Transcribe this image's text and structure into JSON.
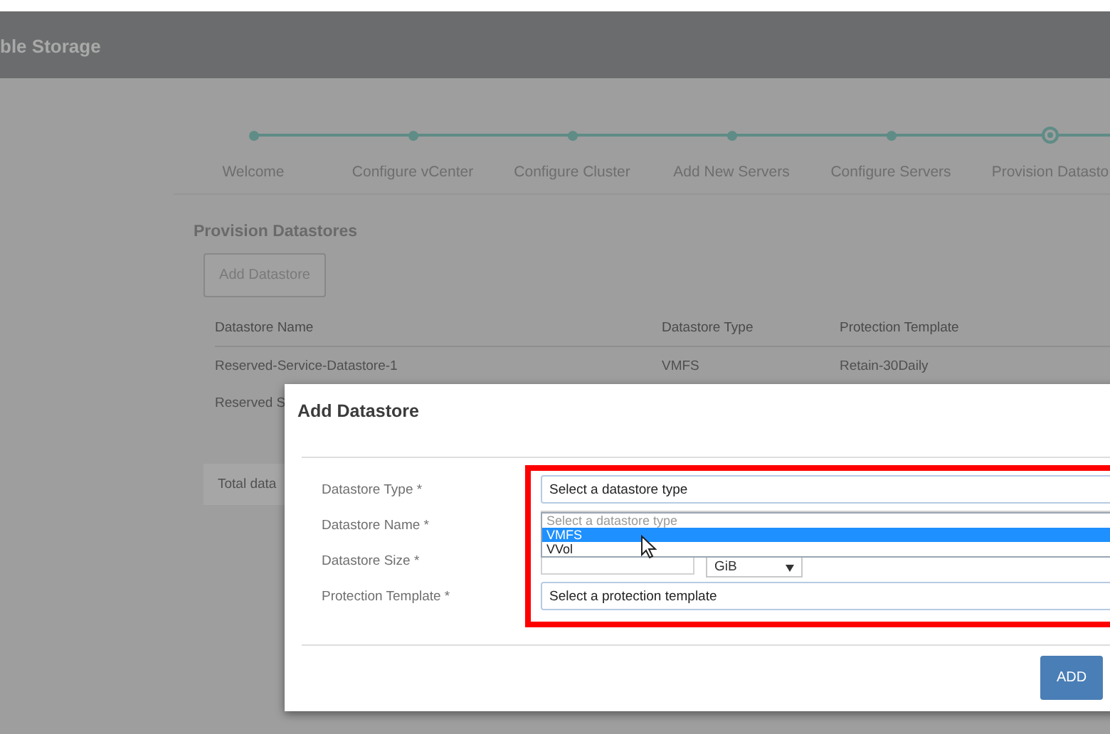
{
  "header": {
    "title": "ble Storage"
  },
  "steps": [
    {
      "label": "Welcome",
      "current": false
    },
    {
      "label": "Configure vCenter",
      "current": false
    },
    {
      "label": "Configure Cluster",
      "current": false
    },
    {
      "label": "Add New Servers",
      "current": false
    },
    {
      "label": "Configure Servers",
      "current": false
    },
    {
      "label": "Provision Datasto",
      "current": true
    }
  ],
  "section": {
    "title": "Provision Datastores",
    "add_button": "Add Datastore"
  },
  "table": {
    "columns": [
      "Datastore Name",
      "Datastore Type",
      "Protection Template"
    ],
    "rows": [
      [
        "Reserved-Service-Datastore-1",
        "VMFS",
        "Retain-30Daily"
      ],
      [
        "Reserved S"
      ]
    ]
  },
  "total": "Total data",
  "dialog": {
    "title": "Add Datastore",
    "fields": [
      {
        "kind": "select",
        "label": "Datastore Type *",
        "value": "Select a datastore type"
      },
      {
        "kind": "text",
        "label": "Datastore Name *"
      },
      {
        "kind": "size",
        "label": "Datastore Size *",
        "unit": "GiB"
      },
      {
        "kind": "select",
        "label": "Protection Template *",
        "value": "Select a protection template"
      }
    ],
    "dropdown": [
      {
        "label": "Select a datastore type",
        "disabled": true,
        "selected": false
      },
      {
        "label": "VMFS",
        "disabled": false,
        "selected": true
      },
      {
        "label": "VVol",
        "disabled": false,
        "selected": false
      }
    ],
    "buttons": [
      "ADD"
    ]
  }
}
